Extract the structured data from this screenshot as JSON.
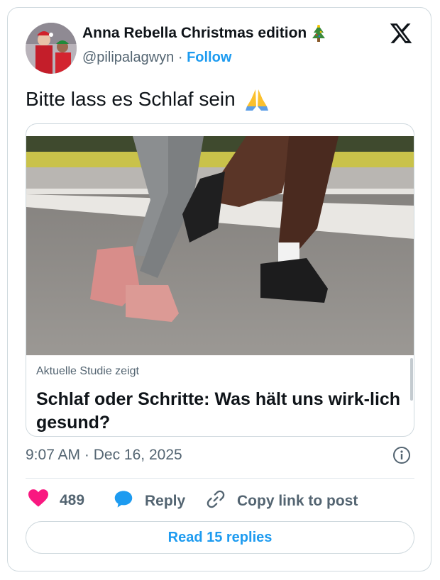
{
  "author": {
    "name": "Anna Rebella Christmas edition",
    "handle": "@pilipalagwyn",
    "separator": "·",
    "follow_label": "Follow"
  },
  "icons": {
    "name_emoji": "christmas-tree-icon",
    "text_emoji": "folded-hands-icon",
    "brand": "x-logo-icon",
    "info": "info-icon",
    "like": "heart-icon",
    "reply": "speech-bubble-icon",
    "copy": "link-icon"
  },
  "tweet": {
    "text": "Bitte lass es Schlaf sein"
  },
  "link_card": {
    "source": "Aktuelle Studie zeigt",
    "title": "Schlaf oder Schritte: Was hält uns wirk-lich gesund?"
  },
  "meta": {
    "time": "9:07 AM",
    "separator": "·",
    "date": "Dec 16, 2025"
  },
  "actions": {
    "likes": "489",
    "reply_label": "Reply",
    "copy_label": "Copy link to post"
  },
  "read_replies_label": "Read 15 replies",
  "colors": {
    "accent": "#1d9bf0",
    "heart": "#f91880",
    "secondary_text": "#536471",
    "border": "#cfd9de"
  }
}
